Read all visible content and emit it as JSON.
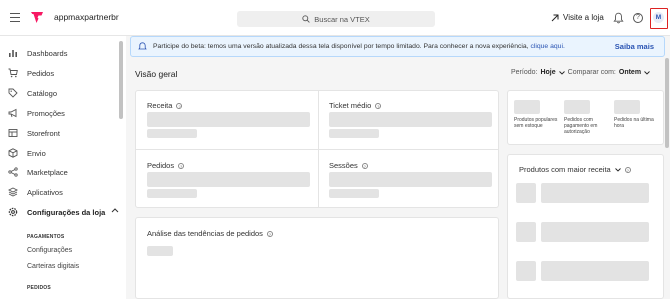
{
  "topbar": {
    "account_name": "appmaxpartnerbr",
    "search_placeholder": "Buscar na VTEX",
    "visit_store": "Visite a loja",
    "avatar_initial": "M",
    "brand_color": "#f71963"
  },
  "sidebar": {
    "items": [
      {
        "label": "Dashboards",
        "icon": "dashboard-icon"
      },
      {
        "label": "Pedidos",
        "icon": "cart-icon"
      },
      {
        "label": "Catálogo",
        "icon": "tag-icon"
      },
      {
        "label": "Promoções",
        "icon": "megaphone-icon"
      },
      {
        "label": "Storefront",
        "icon": "storefront-icon"
      },
      {
        "label": "Envio",
        "icon": "box-icon"
      },
      {
        "label": "Marketplace",
        "icon": "share-icon"
      },
      {
        "label": "Aplicativos",
        "icon": "layers-icon"
      },
      {
        "label": "Configurações da loja",
        "icon": "gear-icon"
      }
    ],
    "sections": [
      {
        "heading": "PAGAMENTOS",
        "items": [
          "Configurações",
          "Carteiras digitais"
        ]
      },
      {
        "heading": "PEDIDOS",
        "items": []
      }
    ]
  },
  "banner": {
    "text": "Participe do beta: temos uma versão atualizada dessa tela disponível por tempo limitado. Para conhecer a nova experiência,",
    "link": "clique aqui.",
    "more": "Saiba mais"
  },
  "main": {
    "title": "Visão geral",
    "period_label": "Período:",
    "period_value": "Hoje",
    "compare_label": "Comparar com:",
    "compare_value": "Ontem",
    "metrics": [
      "Receita",
      "Ticket médio",
      "Pedidos",
      "Sessões"
    ],
    "trends_title": "Análise das tendências de pedidos",
    "products_title": "Produtos com maior receita",
    "small_cards": [
      "Produtos populares sem estoque",
      "Pedidos com pagamento em autorização",
      "Pedidos na última hora"
    ]
  }
}
